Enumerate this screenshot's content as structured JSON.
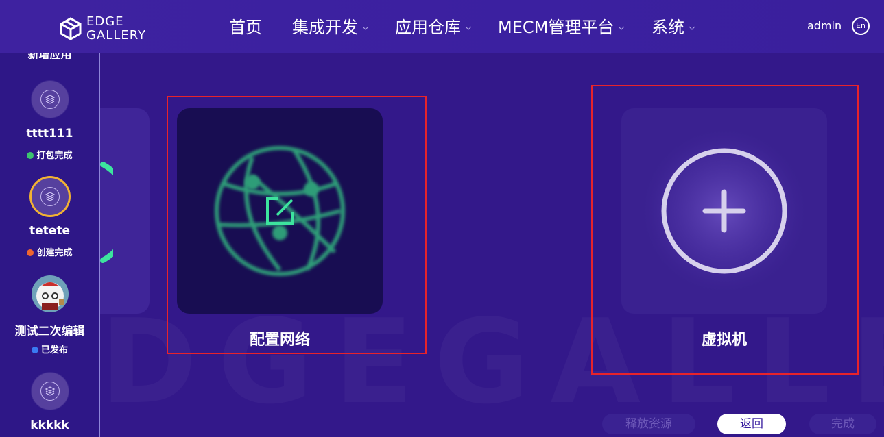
{
  "header": {
    "logo_line1": "EDGE",
    "logo_line2": "GALLERY",
    "nav": [
      {
        "label": "首页",
        "has_dropdown": false
      },
      {
        "label": "集成开发",
        "has_dropdown": true
      },
      {
        "label": "应用仓库",
        "has_dropdown": true
      },
      {
        "label": "MECM管理平台",
        "has_dropdown": true
      },
      {
        "label": "系统",
        "has_dropdown": true
      }
    ],
    "user": "admin",
    "lang_toggle": "En"
  },
  "sidebar": {
    "top_cut_label": "新增应用",
    "items": [
      {
        "name": "tttt111",
        "status": "打包完成",
        "status_color": "#3cc36f",
        "icon": "layers-icon",
        "selected": false
      },
      {
        "name": "tetete",
        "status": "创建完成",
        "status_color": "#f0662e",
        "icon": "layers-icon",
        "selected": true
      },
      {
        "name": "测试二次编辑",
        "status": "已发布",
        "status_color": "#3a7bf2",
        "icon": "panda-avatar",
        "selected": false
      },
      {
        "name": "kkkkk",
        "status": "",
        "status_color": "",
        "icon": "layers-icon",
        "selected": false
      }
    ]
  },
  "main": {
    "cards": [
      {
        "label": "配置网络",
        "icon": "globe-edit-icon"
      },
      {
        "label": "虚拟机",
        "icon": "add-circle-icon"
      }
    ],
    "buttons": {
      "release": "释放资源",
      "back": "返回",
      "done": "完成"
    }
  },
  "colors": {
    "background": "#33188a",
    "header": "#3e22a0",
    "accent_green": "#3de39e",
    "highlight_red": "#e8232b",
    "selected_ring": "#f2b233"
  }
}
